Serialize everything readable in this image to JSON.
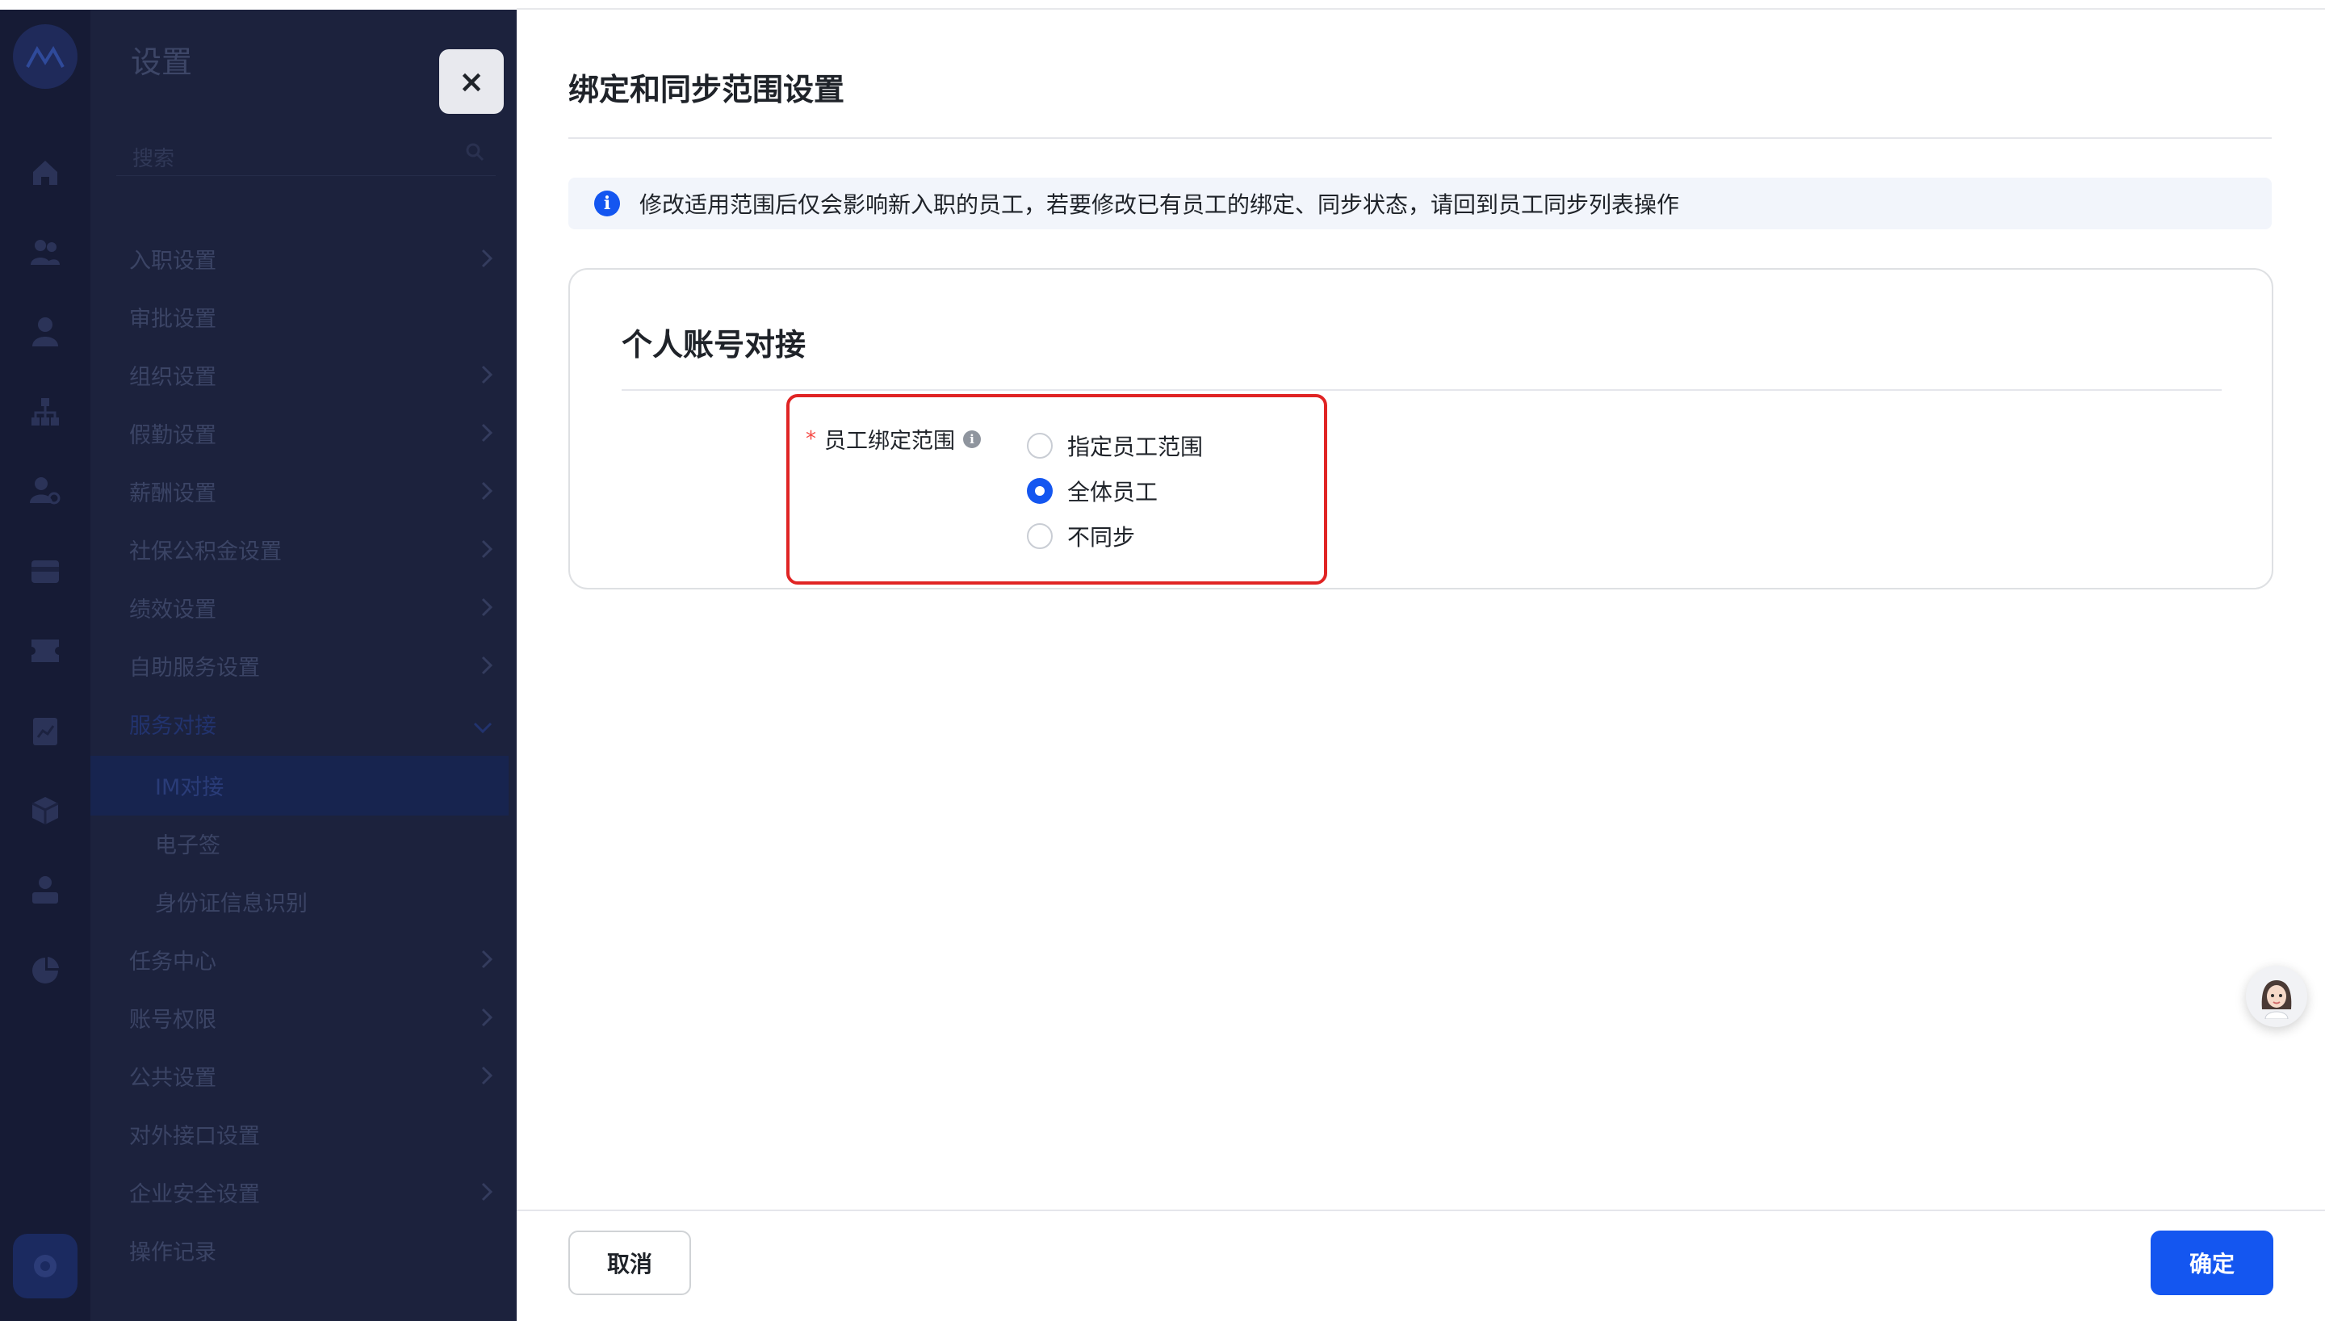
{
  "menu": {
    "title": "设置",
    "search_placeholder": "搜索",
    "items": [
      {
        "label": "入职设置"
      },
      {
        "label": "审批设置"
      },
      {
        "label": "组织设置"
      },
      {
        "label": "假勤设置"
      },
      {
        "label": "薪酬设置"
      },
      {
        "label": "社保公积金设置"
      },
      {
        "label": "绩效设置"
      },
      {
        "label": "自助服务设置"
      },
      {
        "label": "服务对接"
      },
      {
        "label": "IM对接"
      },
      {
        "label": "电子签"
      },
      {
        "label": "身份证信息识别"
      },
      {
        "label": "任务中心"
      },
      {
        "label": "账号权限"
      },
      {
        "label": "公共设置"
      },
      {
        "label": "对外接口设置"
      },
      {
        "label": "企业安全设置"
      },
      {
        "label": "操作记录"
      }
    ]
  },
  "close_label": "×",
  "drawer": {
    "title": "绑定和同步范围设置",
    "notice": "修改适用范围后仅会影响新入职的员工，若要修改已有员工的绑定、同步状态，请回到员工同步列表操作",
    "card": {
      "title": "个人账号对接",
      "field_label": "员工绑定范围",
      "required_mark": "*",
      "options": [
        {
          "label": "指定员工范围",
          "checked": false
        },
        {
          "label": "全体员工",
          "checked": true
        },
        {
          "label": "不同步",
          "checked": false
        }
      ]
    }
  },
  "footer": {
    "cancel_label": "取消",
    "ok_label": "确定"
  },
  "colors": {
    "accent": "#1456f0",
    "highlight_border": "#e02424",
    "rail_bg": "#161b35",
    "menu_bg": "#1c223d"
  }
}
